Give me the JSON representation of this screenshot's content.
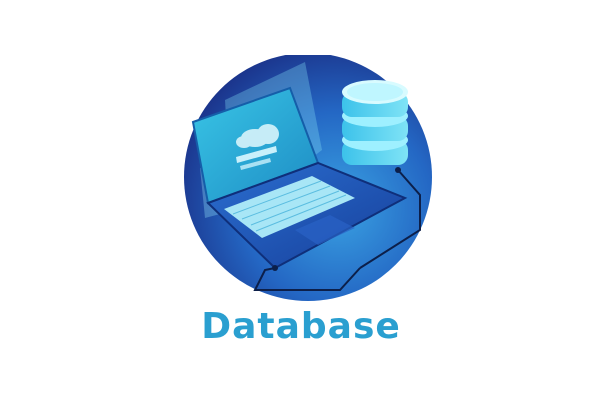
{
  "caption": {
    "text": "Database"
  },
  "colors": {
    "circle_outer": "#1a3d8f",
    "circle_inner": "#2f8fd6",
    "screen": "#2bb3d9",
    "keyboard": "#a8e6f6",
    "database": "#68d7f2",
    "caption": "#2a9fd0"
  },
  "icons": {
    "main": "laptop-database-cloud-icon"
  }
}
